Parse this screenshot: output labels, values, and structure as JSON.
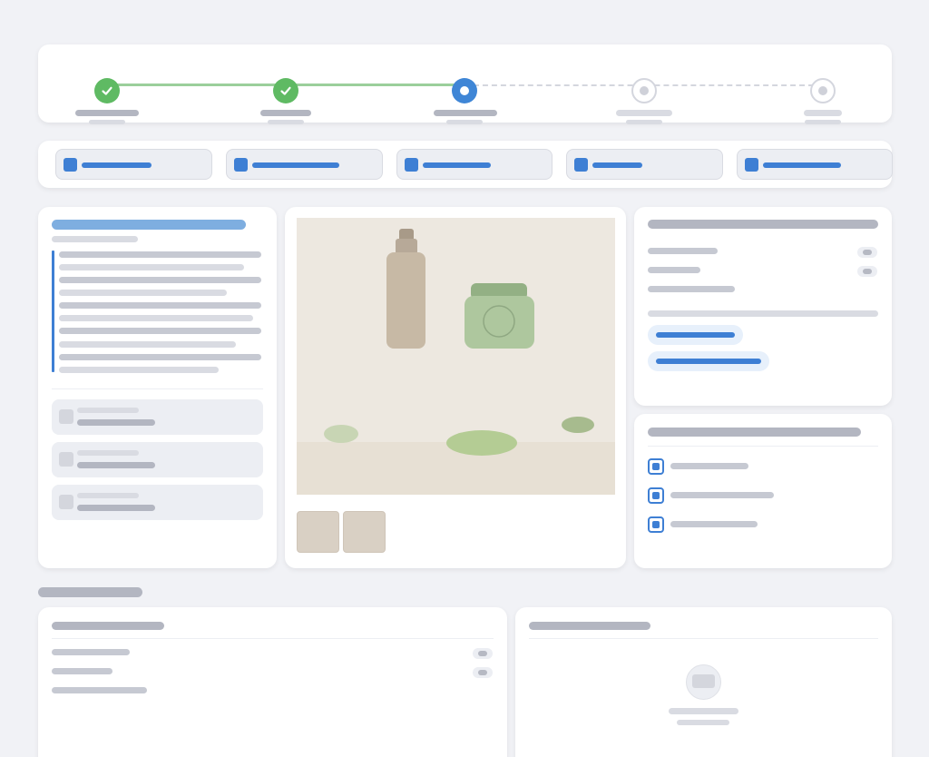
{
  "stepper": {
    "steps": [
      {
        "state": "done",
        "icon": "check-icon"
      },
      {
        "state": "done",
        "icon": "check-icon"
      },
      {
        "state": "current",
        "icon": "dot-icon"
      },
      {
        "state": "upcoming",
        "icon": "dot-icon"
      },
      {
        "state": "upcoming",
        "icon": "dot-icon"
      }
    ],
    "completed_count": 2
  },
  "tabs": {
    "count": 5,
    "icon": "square-icon"
  },
  "product_image": {
    "thumbnail_count": 2
  },
  "options": {
    "checkbox_count": 3,
    "checked": [
      true,
      true,
      true
    ]
  },
  "colors": {
    "accent": "#3e7fd4",
    "success": "#5fba63",
    "background": "#f1f2f6",
    "card": "#ffffff"
  }
}
